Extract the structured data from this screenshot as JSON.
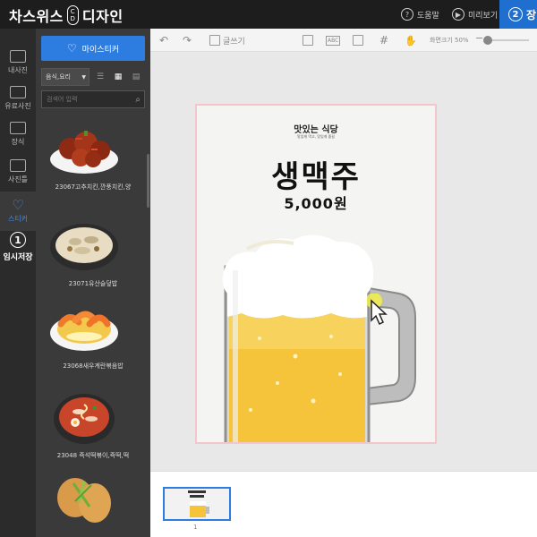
{
  "topbar": {
    "brand_left": "차스위스",
    "brand_cd_top": "C",
    "brand_cd_bottom": "D",
    "brand_right": "디자인",
    "help_label": "도움말",
    "preview_label": "미리보기",
    "save_num": "2",
    "save_label": "장"
  },
  "leftnav": {
    "items": [
      {
        "label": "내사진"
      },
      {
        "label": "유료사진"
      },
      {
        "label": "장식"
      },
      {
        "label": "사진틀"
      },
      {
        "label": "스티커"
      },
      {
        "label": "임시저장",
        "num": "1"
      }
    ]
  },
  "panel": {
    "my_sticker_label": "마이스티커",
    "category": "음식,요리",
    "search_placeholder": "검색어 입력",
    "stickers": [
      {
        "label": "23067고추치킨,깐풍치킨,양"
      },
      {
        "label": "23071유산슬덮밥"
      },
      {
        "label": "23068새우계란볶음밥"
      },
      {
        "label": "23048 즉석떡볶이,즉떡,떡"
      },
      {
        "label": ""
      }
    ]
  },
  "toolbar": {
    "text_tool": "글쓰기",
    "abc_label": "ABC",
    "zoom_label": "화면크기 50%",
    "zoom_level": 0.5
  },
  "page": {
    "header": "맛있는 식당",
    "sub": "맛있게 먹고, 맛있게 즐길",
    "title": "생맥주",
    "price": "5,000원"
  },
  "thumbs": {
    "page_number": "1"
  },
  "colors": {
    "accent": "#2d7de0",
    "topbar_bg": "#1d1d1d",
    "panel_bg": "#3a3a3a",
    "page_border": "#f1c7cc",
    "beer": "#f6c43a"
  }
}
